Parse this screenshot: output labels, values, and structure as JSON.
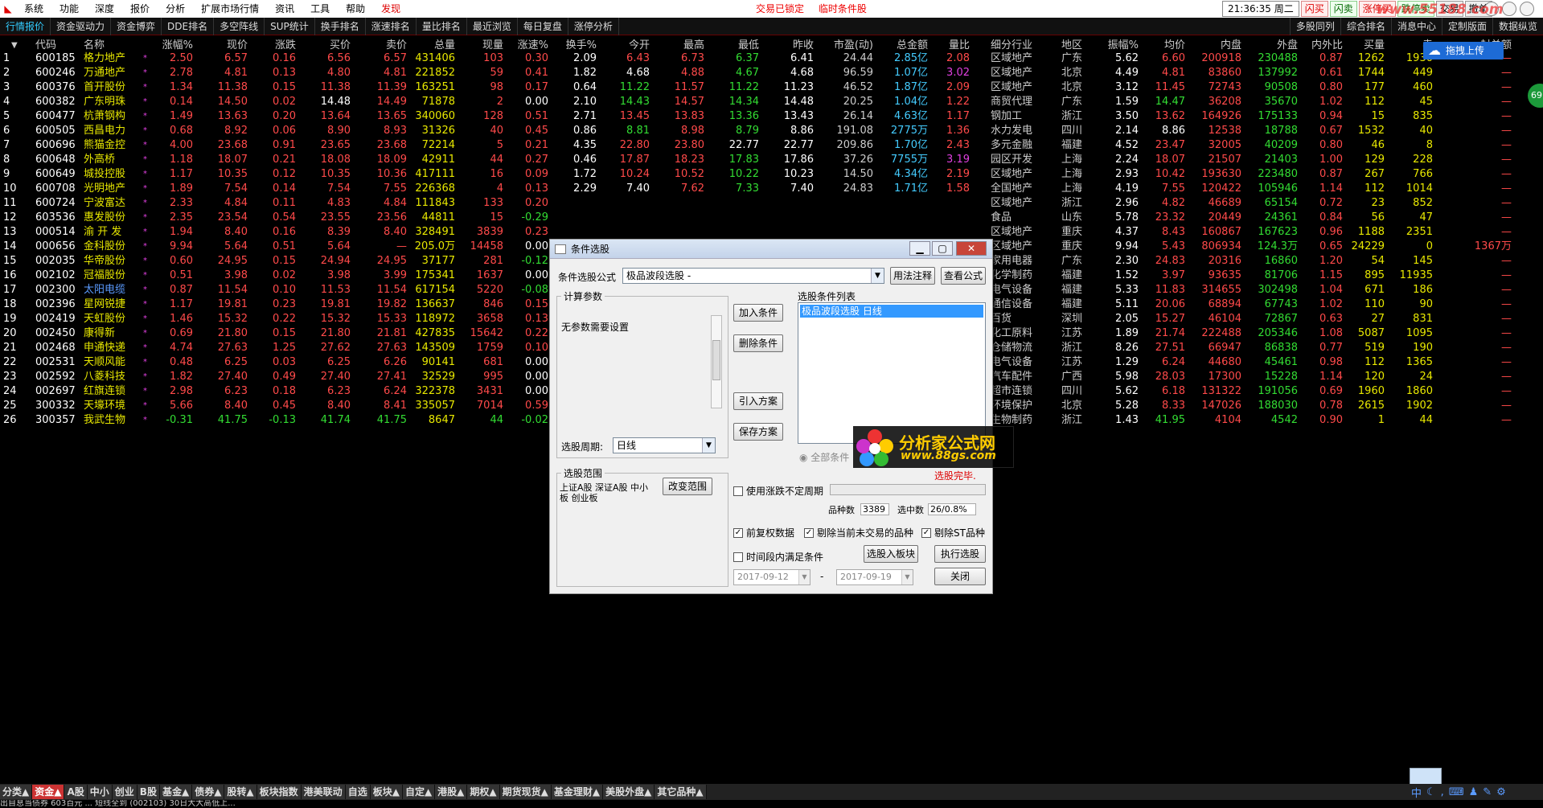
{
  "menubar": {
    "items": [
      "系统",
      "功能",
      "深度",
      "报价",
      "分析",
      "扩展市场行情",
      "资讯",
      "工具",
      "帮助"
    ],
    "discover": "发现",
    "center": [
      "交易已锁定",
      "临时条件股"
    ],
    "clock": "21:36:35 周二",
    "right_buttons": [
      "闪买",
      "闪卖",
      "涨停买",
      "跌停卖",
      "交易",
      "撤单"
    ],
    "watermark": "www.55188.com"
  },
  "tabbar": {
    "tabs": [
      "行情报价",
      "资金驱动力",
      "资金博弈",
      "DDE排名",
      "多空阵线",
      "SUP统计",
      "换手排名",
      "涨速排名",
      "量比排名",
      "最近浏览",
      "每日复盘",
      "涨停分析"
    ],
    "right_tabs": [
      "多股同列",
      "综合排名",
      "消息中心",
      "定制版面",
      "数据纵览"
    ]
  },
  "upload": "拖拽上传",
  "green_badge": "69",
  "table": {
    "headers": [
      "代码",
      "名称",
      "涨幅%",
      "现价",
      "涨跌",
      "买价",
      "卖价",
      "总量",
      "现量",
      "涨速%",
      "换手%",
      "今开",
      "最高",
      "最低",
      "昨收",
      "市盈(动)",
      "总金额",
      "量比",
      "细分行业",
      "地区",
      "振幅%",
      "均价",
      "内盘",
      "外盘",
      "内外比",
      "买量",
      "卖",
      "封单额"
    ],
    "rows": [
      [
        "1",
        "600185",
        "格力地产",
        "2.50",
        "6.57",
        "0.16",
        "6.56",
        "6.57",
        "431406",
        "103",
        "0.30",
        "2.09",
        "6.43",
        "6.73",
        "6.37",
        "6.41",
        "24.44",
        "2.85亿",
        "2.08",
        "区域地产",
        "广东",
        "5.62",
        "6.60",
        "200918",
        "230488",
        "0.87",
        "1262",
        "1930",
        "—"
      ],
      [
        "2",
        "600246",
        "万通地产",
        "2.78",
        "4.81",
        "0.13",
        "4.80",
        "4.81",
        "221852",
        "59",
        "0.41",
        "1.82",
        "4.68",
        "4.88",
        "4.67",
        "4.68",
        "96.59",
        "1.07亿",
        "3.02",
        "区域地产",
        "北京",
        "4.49",
        "4.81",
        "83860",
        "137992",
        "0.61",
        "1744",
        "449",
        "—"
      ],
      [
        "3",
        "600376",
        "首开股份",
        "1.34",
        "11.38",
        "0.15",
        "11.38",
        "11.39",
        "163251",
        "98",
        "0.17",
        "0.64",
        "11.22",
        "11.57",
        "11.22",
        "11.23",
        "46.52",
        "1.87亿",
        "2.09",
        "区域地产",
        "北京",
        "3.12",
        "11.45",
        "72743",
        "90508",
        "0.80",
        "177",
        "460",
        "—"
      ],
      [
        "4",
        "600382",
        "广东明珠",
        "0.14",
        "14.50",
        "0.02",
        "14.48",
        "14.49",
        "71878",
        "2",
        "0.00",
        "2.10",
        "14.43",
        "14.57",
        "14.34",
        "14.48",
        "20.25",
        "1.04亿",
        "1.22",
        "商贸代理",
        "广东",
        "1.59",
        "14.47",
        "36208",
        "35670",
        "1.02",
        "112",
        "45",
        "—"
      ],
      [
        "5",
        "600477",
        "杭萧钢构",
        "1.49",
        "13.63",
        "0.20",
        "13.64",
        "13.65",
        "340060",
        "128",
        "0.51",
        "2.71",
        "13.45",
        "13.83",
        "13.36",
        "13.43",
        "26.14",
        "4.63亿",
        "1.17",
        "钢加工",
        "浙江",
        "3.50",
        "13.62",
        "164926",
        "175133",
        "0.94",
        "15",
        "835",
        "—"
      ],
      [
        "6",
        "600505",
        "西昌电力",
        "0.68",
        "8.92",
        "0.06",
        "8.90",
        "8.93",
        "31326",
        "40",
        "0.45",
        "0.86",
        "8.81",
        "8.98",
        "8.79",
        "8.86",
        "191.08",
        "2775万",
        "1.36",
        "水力发电",
        "四川",
        "2.14",
        "8.86",
        "12538",
        "18788",
        "0.67",
        "1532",
        "40",
        "—"
      ],
      [
        "7",
        "600696",
        "熊猫金控",
        "4.00",
        "23.68",
        "0.91",
        "23.65",
        "23.68",
        "72214",
        "5",
        "0.21",
        "4.35",
        "22.80",
        "23.80",
        "22.77",
        "22.77",
        "209.86",
        "1.70亿",
        "2.43",
        "多元金融",
        "福建",
        "4.52",
        "23.47",
        "32005",
        "40209",
        "0.80",
        "46",
        "8",
        "—"
      ],
      [
        "8",
        "600648",
        "外高桥",
        "1.18",
        "18.07",
        "0.21",
        "18.08",
        "18.09",
        "42911",
        "44",
        "0.27",
        "0.46",
        "17.87",
        "18.23",
        "17.83",
        "17.86",
        "37.26",
        "7755万",
        "3.19",
        "园区开发",
        "上海",
        "2.24",
        "18.07",
        "21507",
        "21403",
        "1.00",
        "129",
        "228",
        "—"
      ],
      [
        "9",
        "600649",
        "城投控股",
        "1.17",
        "10.35",
        "0.12",
        "10.35",
        "10.36",
        "417111",
        "16",
        "0.09",
        "1.72",
        "10.24",
        "10.52",
        "10.22",
        "10.23",
        "14.50",
        "4.34亿",
        "2.19",
        "区域地产",
        "上海",
        "2.93",
        "10.42",
        "193630",
        "223480",
        "0.87",
        "267",
        "766",
        "—"
      ],
      [
        "10",
        "600708",
        "光明地产",
        "1.89",
        "7.54",
        "0.14",
        "7.54",
        "7.55",
        "226368",
        "4",
        "0.13",
        "2.29",
        "7.40",
        "7.62",
        "7.33",
        "7.40",
        "24.83",
        "1.71亿",
        "1.58",
        "全国地产",
        "上海",
        "4.19",
        "7.55",
        "120422",
        "105946",
        "1.14",
        "112",
        "1014",
        "—"
      ],
      [
        "11",
        "600724",
        "宁波富达",
        "2.33",
        "4.84",
        "0.11",
        "4.83",
        "4.84",
        "111843",
        "133",
        "0.20",
        "",
        "",
        "",
        "",
        "",
        "",
        "",
        "",
        "区域地产",
        "浙江",
        "2.96",
        "4.82",
        "46689",
        "65154",
        "0.72",
        "23",
        "852",
        "—"
      ],
      [
        "12",
        "603536",
        "惠发股份",
        "2.35",
        "23.54",
        "0.54",
        "23.55",
        "23.56",
        "44811",
        "15",
        "-0.29",
        "",
        "",
        "",
        "",
        "",
        "",
        "",
        "",
        "食品",
        "山东",
        "5.78",
        "23.32",
        "20449",
        "24361",
        "0.84",
        "56",
        "47",
        "—"
      ],
      [
        "13",
        "000514",
        "渝 开 发",
        "1.94",
        "8.40",
        "0.16",
        "8.39",
        "8.40",
        "328491",
        "3839",
        "0.23",
        "",
        "",
        "",
        "",
        "",
        "",
        "",
        "",
        "区域地产",
        "重庆",
        "4.37",
        "8.43",
        "160867",
        "167623",
        "0.96",
        "1188",
        "2351",
        "—"
      ],
      [
        "14",
        "000656",
        "金科股份",
        "9.94",
        "5.64",
        "0.51",
        "5.64",
        "—",
        "205.0万",
        "14458",
        "0.00",
        "",
        "",
        "",
        "",
        "",
        "",
        "",
        "",
        "区域地产",
        "重庆",
        "9.94",
        "5.43",
        "806934",
        "124.3万",
        "0.65",
        "24229",
        "0",
        "1367万"
      ],
      [
        "15",
        "002035",
        "华帝股份",
        "0.60",
        "24.95",
        "0.15",
        "24.94",
        "24.95",
        "37177",
        "281",
        "-0.12",
        "",
        "",
        "",
        "",
        "",
        "",
        "",
        "",
        "家用电器",
        "广东",
        "2.30",
        "24.83",
        "20316",
        "16860",
        "1.20",
        "54",
        "145",
        "—"
      ],
      [
        "16",
        "002102",
        "冠福股份",
        "0.51",
        "3.98",
        "0.02",
        "3.98",
        "3.99",
        "175341",
        "1637",
        "0.00",
        "",
        "",
        "",
        "",
        "",
        "",
        "",
        "",
        "化学制药",
        "福建",
        "1.52",
        "3.97",
        "93635",
        "81706",
        "1.15",
        "895",
        "11935",
        "—"
      ],
      [
        "17",
        "002300",
        "太阳电缆",
        "0.87",
        "11.54",
        "0.10",
        "11.53",
        "11.54",
        "617154",
        "5220",
        "-0.08",
        "",
        "",
        "",
        "",
        "",
        "",
        "",
        "",
        "电气设备",
        "福建",
        "5.33",
        "11.83",
        "314655",
        "302498",
        "1.04",
        "671",
        "186",
        "—"
      ],
      [
        "18",
        "002396",
        "星网锐捷",
        "1.17",
        "19.81",
        "0.23",
        "19.81",
        "19.82",
        "136637",
        "846",
        "0.15",
        "",
        "",
        "",
        "",
        "",
        "",
        "",
        "",
        "通信设备",
        "福建",
        "5.11",
        "20.06",
        "68894",
        "67743",
        "1.02",
        "110",
        "90",
        "—"
      ],
      [
        "19",
        "002419",
        "天虹股份",
        "1.46",
        "15.32",
        "0.22",
        "15.32",
        "15.33",
        "118972",
        "3658",
        "0.13",
        "",
        "",
        "",
        "",
        "",
        "",
        "",
        "",
        "百货",
        "深圳",
        "2.05",
        "15.27",
        "46104",
        "72867",
        "0.63",
        "27",
        "831",
        "—"
      ],
      [
        "20",
        "002450",
        "康得新",
        "0.69",
        "21.80",
        "0.15",
        "21.80",
        "21.81",
        "427835",
        "15642",
        "0.22",
        "",
        "",
        "",
        "",
        "",
        "",
        "",
        "",
        "化工原料",
        "江苏",
        "1.89",
        "21.74",
        "222488",
        "205346",
        "1.08",
        "5087",
        "1095",
        "—"
      ],
      [
        "21",
        "002468",
        "申通快递",
        "4.74",
        "27.63",
        "1.25",
        "27.62",
        "27.63",
        "143509",
        "1759",
        "0.10",
        "",
        "",
        "",
        "",
        "",
        "",
        "",
        "",
        "仓储物流",
        "浙江",
        "8.26",
        "27.51",
        "66947",
        "86838",
        "0.77",
        "519",
        "190",
        "—"
      ],
      [
        "22",
        "002531",
        "天顺风能",
        "0.48",
        "6.25",
        "0.03",
        "6.25",
        "6.26",
        "90141",
        "681",
        "0.00",
        "",
        "",
        "",
        "",
        "",
        "",
        "",
        "",
        "电气设备",
        "江苏",
        "1.29",
        "6.24",
        "44680",
        "45461",
        "0.98",
        "112",
        "1365",
        "—"
      ],
      [
        "23",
        "002592",
        "八菱科技",
        "1.82",
        "27.40",
        "0.49",
        "27.40",
        "27.41",
        "32529",
        "995",
        "0.00",
        "",
        "",
        "",
        "",
        "",
        "",
        "",
        "",
        "汽车配件",
        "广西",
        "5.98",
        "28.03",
        "17300",
        "15228",
        "1.14",
        "120",
        "24",
        "—"
      ],
      [
        "24",
        "002697",
        "红旗连锁",
        "2.98",
        "6.23",
        "0.18",
        "6.23",
        "6.24",
        "322378",
        "3431",
        "0.00",
        "",
        "",
        "",
        "",
        "",
        "",
        "",
        "",
        "超市连锁",
        "四川",
        "5.62",
        "6.18",
        "131322",
        "191056",
        "0.69",
        "1960",
        "1860",
        "—"
      ],
      [
        "25",
        "300332",
        "天壕环境",
        "5.66",
        "8.40",
        "0.45",
        "8.40",
        "8.41",
        "335057",
        "7014",
        "0.59",
        "",
        "",
        "",
        "",
        "",
        "",
        "",
        "",
        "环境保护",
        "北京",
        "5.28",
        "8.33",
        "147026",
        "188030",
        "0.78",
        "2615",
        "1902",
        "—"
      ],
      [
        "26",
        "300357",
        "我武生物",
        "-0.31",
        "41.75",
        "-0.13",
        "41.74",
        "41.75",
        "8647",
        "44",
        "-0.02",
        "",
        "",
        "",
        "",
        "",
        "",
        "",
        "",
        "生物制药",
        "浙江",
        "1.43",
        "41.95",
        "4104",
        "4542",
        "0.90",
        "1",
        "44",
        "—"
      ]
    ]
  },
  "dialog": {
    "title": "条件选股",
    "formula_label": "条件选股公式",
    "formula_value": "极品波段选股 -",
    "usage_button": "用法注释",
    "view_formula_button": "查看公式",
    "params_group": "计算参数",
    "params_text": "无参数需要设置",
    "period_label": "选股周期:",
    "period_value": "日线",
    "add_condition": "加入条件",
    "delete_condition": "删除条件",
    "import_plan": "引入方案",
    "save_plan": "保存方案",
    "list_title": "选股条件列表",
    "list_item": "极品波段选股  日线",
    "all_conditions": "全部条件",
    "select_done": "选股完毕.",
    "range_group": "选股范围",
    "range_text": "上证A股 深证A股 中小板 创业板",
    "change_range": "改变范围",
    "use_limit_period": "使用涨跌不定周期",
    "count_label": "品种数",
    "count_value": "3389",
    "selected_label": "选中数",
    "selected_value": "26/0.8%",
    "pre_adjust": "前复权数据",
    "exclude_untraded": "剔除当前未交易的品种",
    "exclude_st": "剔除ST品种",
    "time_condition": "时间段内满足条件",
    "to_block": "选股入板块",
    "execute": "执行选股",
    "date_from": "2017-09-12",
    "date_sep": "-",
    "date_to": "2017-09-19",
    "close": "关闭"
  },
  "watermark2": {
    "title": "分析家公式网",
    "url": "www.88gs.com"
  },
  "bottombar": [
    "分类▲",
    "资金▲",
    "A股",
    "中小",
    "创业",
    "B股",
    "基金▲",
    "债券▲",
    "股转▲",
    "板块指数",
    "港美联动",
    "自选",
    "板块▲",
    "自定▲",
    "港股▲",
    "期权▲",
    "期货现货▲",
    "基金理财▲",
    "美股外盘▲",
    "其它品种▲"
  ],
  "status_text": "出自息当债券 603百元 ... 短线全到 (002103) 30日大大高低上..."
}
